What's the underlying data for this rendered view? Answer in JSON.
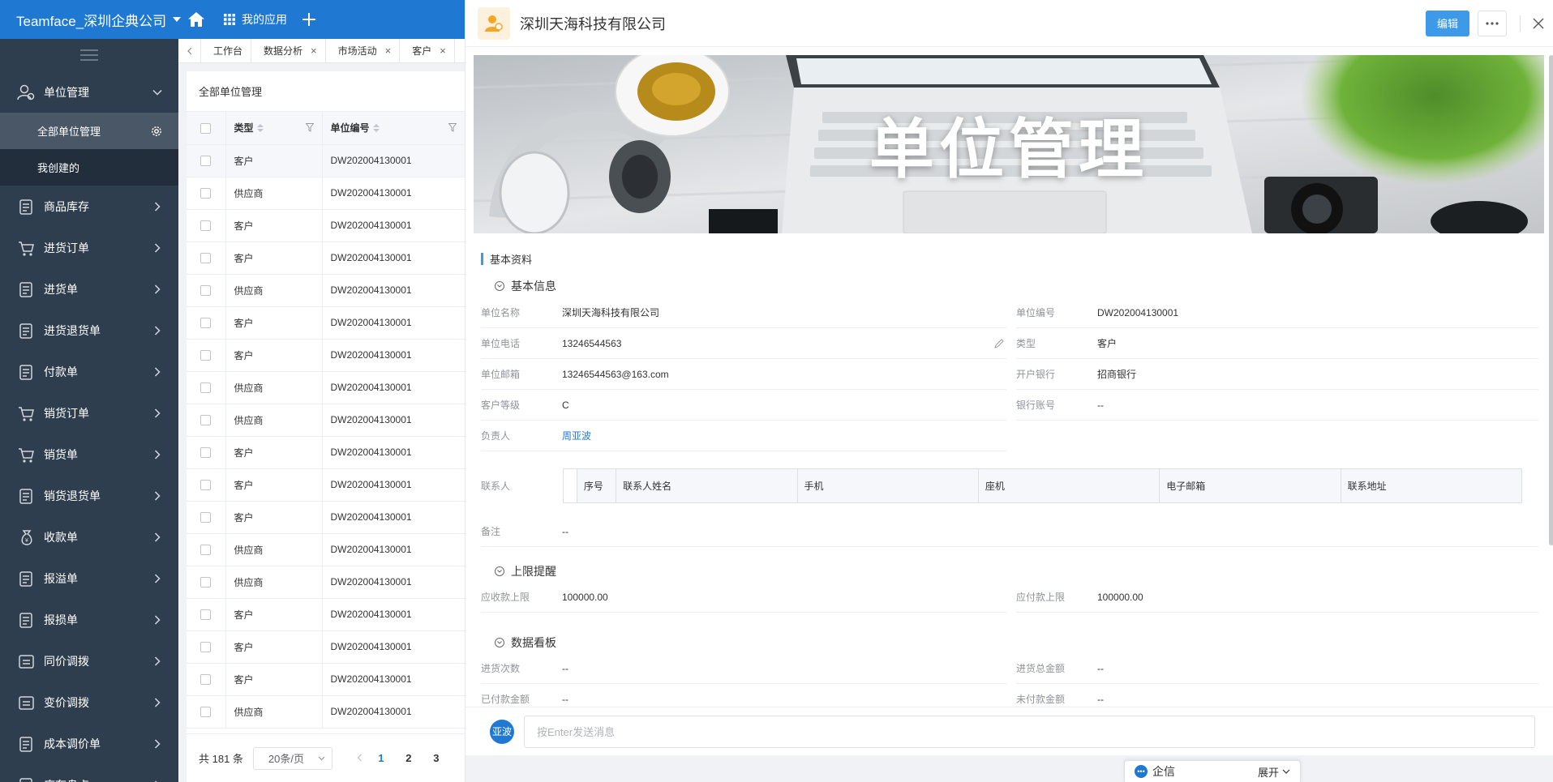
{
  "topbar": {
    "company": "Teamface_深圳企典公司",
    "apps_label": "我的应用"
  },
  "sidebar": {
    "items": [
      {
        "label": "单位管理",
        "icon": "users-icon",
        "expanded": true
      },
      {
        "label": "商品库存",
        "icon": "inventory-icon"
      },
      {
        "label": "进货订单",
        "icon": "cart-in-icon"
      },
      {
        "label": "进货单",
        "icon": "document-icon"
      },
      {
        "label": "进货退货单",
        "icon": "clipboard-icon"
      },
      {
        "label": "付款单",
        "icon": "payment-icon"
      },
      {
        "label": "销货订单",
        "icon": "cart-icon"
      },
      {
        "label": "销货单",
        "icon": "cart-icon"
      },
      {
        "label": "销货退货单",
        "icon": "return-icon"
      },
      {
        "label": "收款单",
        "icon": "money-bag-icon"
      },
      {
        "label": "报溢单",
        "icon": "report-icon"
      },
      {
        "label": "报损单",
        "icon": "report-loss-icon"
      },
      {
        "label": "同价调拨",
        "icon": "transfer-icon"
      },
      {
        "label": "变价调拨",
        "icon": "transfer-price-icon"
      },
      {
        "label": "成本调价单",
        "icon": "cost-icon"
      },
      {
        "label": "库存盘点",
        "icon": "stock-icon"
      }
    ],
    "sub_items": [
      {
        "label": "全部单位管理",
        "active": true
      },
      {
        "label": "我创建的",
        "active": false
      }
    ]
  },
  "tabs": [
    {
      "label": "工作台",
      "closable": false
    },
    {
      "label": "数据分析",
      "closable": true
    },
    {
      "label": "市场活动",
      "closable": true
    },
    {
      "label": "客户",
      "closable": true
    }
  ],
  "list": {
    "title": "全部单位管理",
    "columns": {
      "type": "类型",
      "code": "单位编号"
    },
    "rows": [
      {
        "type": "客户",
        "code": "DW202004130001"
      },
      {
        "type": "供应商",
        "code": "DW202004130001"
      },
      {
        "type": "客户",
        "code": "DW202004130001"
      },
      {
        "type": "客户",
        "code": "DW202004130001"
      },
      {
        "type": "供应商",
        "code": "DW202004130001"
      },
      {
        "type": "客户",
        "code": "DW202004130001"
      },
      {
        "type": "客户",
        "code": "DW202004130001"
      },
      {
        "type": "供应商",
        "code": "DW202004130001"
      },
      {
        "type": "供应商",
        "code": "DW202004130001"
      },
      {
        "type": "客户",
        "code": "DW202004130001"
      },
      {
        "type": "客户",
        "code": "DW202004130001"
      },
      {
        "type": "客户",
        "code": "DW202004130001"
      },
      {
        "type": "供应商",
        "code": "DW202004130001"
      },
      {
        "type": "供应商",
        "code": "DW202004130001"
      },
      {
        "type": "客户",
        "code": "DW202004130001"
      },
      {
        "type": "客户",
        "code": "DW202004130001"
      },
      {
        "type": "客户",
        "code": "DW202004130001"
      },
      {
        "type": "供应商",
        "code": "DW202004130001"
      }
    ],
    "pager": {
      "total": "共 181 条",
      "page_size": "20条/页",
      "pages": [
        "1",
        "2",
        "3"
      ],
      "current": "1"
    }
  },
  "detail": {
    "title": "深圳天海科技有限公司",
    "edit_label": "编辑",
    "banner_text": "单位管理",
    "section_title": "基本资料",
    "groups": {
      "basic": "基本信息",
      "limit": "上限提醒",
      "board": "数据看板"
    },
    "fields": {
      "name": {
        "label": "单位名称",
        "value": "深圳天海科技有限公司"
      },
      "code": {
        "label": "单位编号",
        "value": "DW202004130001"
      },
      "phone": {
        "label": "单位电话",
        "value": "13246544563"
      },
      "type": {
        "label": "类型",
        "value": "客户"
      },
      "email": {
        "label": "单位邮箱",
        "value": "13246544563@163.com"
      },
      "bank": {
        "label": "开户银行",
        "value": "招商银行"
      },
      "level": {
        "label": "客户等级",
        "value": "C"
      },
      "account": {
        "label": "银行账号",
        "value": "--"
      },
      "owner": {
        "label": "负责人",
        "value": "周亚波"
      },
      "contact": {
        "label": "联系人"
      },
      "remark": {
        "label": "备注",
        "value": "--"
      },
      "recv_limit": {
        "label": "应收款上限",
        "value": "100000.00"
      },
      "pay_limit": {
        "label": "应付款上限",
        "value": "100000.00"
      },
      "purchase_count": {
        "label": "进货次数",
        "value": "--"
      },
      "purchase_total": {
        "label": "进货总金额",
        "value": "--"
      },
      "paid_amount": {
        "label": "已付款金额",
        "value": "--"
      },
      "unpaid_amount": {
        "label": "未付款金额",
        "value": "--"
      }
    },
    "contact_columns": [
      "序号",
      "联系人姓名",
      "手机",
      "座机",
      "电子邮箱",
      "联系地址"
    ]
  },
  "chat": {
    "avatar_text": "亚波",
    "placeholder": "按Enter发送消息"
  },
  "qixin": {
    "label": "企信",
    "expand": "展开"
  },
  "colors": {
    "brand": "#1f78d1",
    "sidebar": "#2f3e4f",
    "edit_button": "#3d9ae8"
  }
}
